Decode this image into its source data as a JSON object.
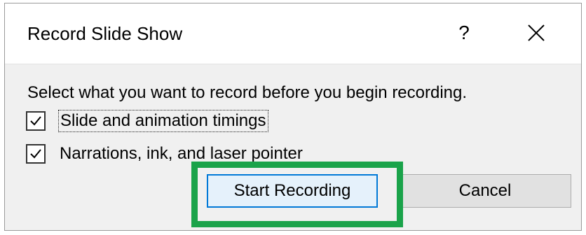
{
  "dialog": {
    "title": "Record Slide Show",
    "help_label": "?",
    "instruction": "Select what you want to record before you begin recording.",
    "options": [
      {
        "label": "Slide and animation timings",
        "checked": true
      },
      {
        "label": "Narrations, ink, and laser pointer",
        "checked": true
      }
    ],
    "buttons": {
      "start_label": "Start Recording",
      "cancel_label": "Cancel"
    }
  },
  "colors": {
    "accent": "#0078d7",
    "highlight": "#1aa34a"
  },
  "icons": {
    "close": "close-icon",
    "check": "checkmark-icon"
  }
}
